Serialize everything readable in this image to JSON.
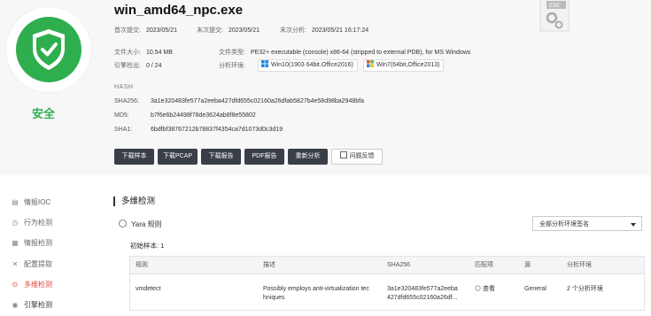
{
  "file": {
    "name": "win_amd64_npc.exe",
    "first_submit_label": "首次提交:",
    "first_submit": "2023/05/21",
    "last_submit_label": "末次提交:",
    "last_submit": "2023/05/21",
    "last_analysis_label": "末次分析:",
    "last_analysis": "2023/05/21 16:17:24",
    "size_label": "文件大小:",
    "size": "10.54 MB",
    "type_label": "文件类型:",
    "type": "PE32+ executable (console) x86-64 (stripped to external PDB), for MS Windows",
    "engine_label": "引擎检出:",
    "engine": "0 / 24",
    "env_label": "分析环境:",
    "env1": "Win10(1903 64bit,Office2016)",
    "env2": "Win7(64bit,Office2013)",
    "verdict": "安全",
    "exe_badge": "EXE"
  },
  "hash": {
    "heading": "HASH",
    "sha256_label": "SHA256:",
    "sha256": "3a1e320483fe577a2eeba427dfd655c02160a26dfab5827b4e58d98ba2948bfa",
    "md5_label": "MD5:",
    "md5": "b7f6e6b24498f78de3624ab8f8e55802",
    "sha1_label": "SHA1:",
    "sha1": "6bdfbf38767212b78837f4354ca7d1073d0c3d19"
  },
  "actions": {
    "download_sample": "下载样本",
    "download_pcap": "下载PCAP",
    "download_report": "下载报告",
    "pdf_report": "PDF报告",
    "reanalyze": "重新分析",
    "feedback": "问题反馈"
  },
  "sidebar": {
    "items": [
      {
        "label": "情报IOC",
        "icon": "doc-icon"
      },
      {
        "label": "行为检测",
        "icon": "clock-icon"
      },
      {
        "label": "情报检测",
        "icon": "grid-icon"
      },
      {
        "label": "配置提取",
        "icon": "wrench-icon"
      },
      {
        "label": "多维检测",
        "icon": "magnify-icon"
      },
      {
        "label": "引擎检测",
        "icon": "help-icon"
      }
    ]
  },
  "main": {
    "section_title": "多维检测",
    "yara_title": "Yara 规则",
    "filter_selected": "全部分析环境签名",
    "sample_label": "初始样本: 1",
    "columns": [
      "规则",
      "描述",
      "SHA256",
      "匹配项",
      "源",
      "分析环境"
    ],
    "rows": [
      {
        "rule": "vmdetect",
        "desc": "Possibly employs anti-virtualization tec hniques",
        "sha256": "3a1e320483fe577a2eeba 427dfd655c02160a26df...",
        "match": "查看",
        "source": "General",
        "env": "2 个分析环境"
      }
    ]
  },
  "colors": {
    "safe": "#2fae4e",
    "active": "#e6423a",
    "button": "#3a3f47"
  }
}
